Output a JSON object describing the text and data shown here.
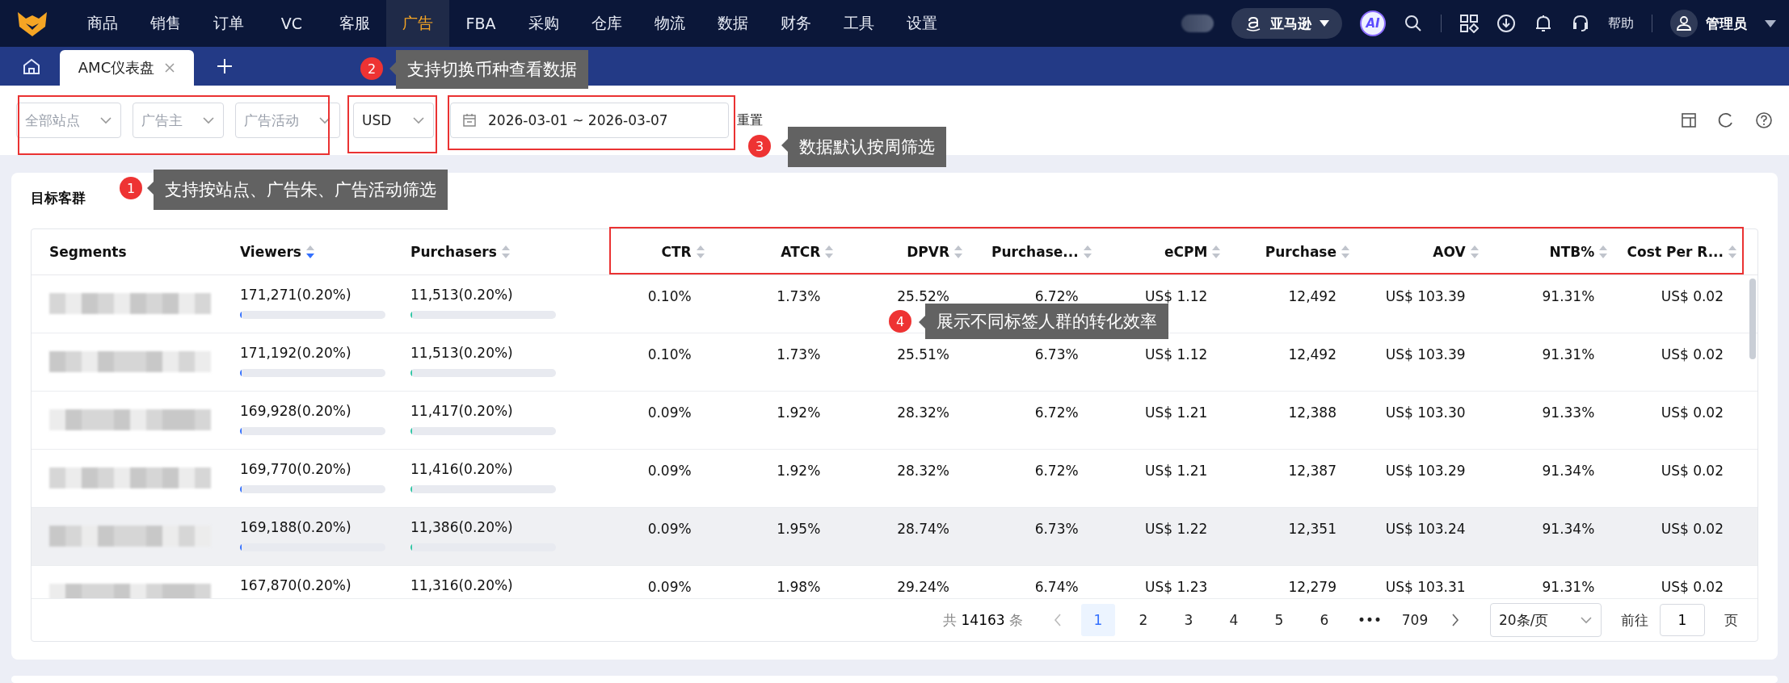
{
  "nav": {
    "items": [
      {
        "label": "商品",
        "selected": false
      },
      {
        "label": "销售",
        "selected": false
      },
      {
        "label": "订单",
        "selected": false
      },
      {
        "label": "VC",
        "selected": false
      },
      {
        "label": "客服",
        "selected": false
      },
      {
        "label": "广告",
        "selected": true
      },
      {
        "label": "FBA",
        "selected": false
      },
      {
        "label": "采购",
        "selected": false
      },
      {
        "label": "仓库",
        "selected": false
      },
      {
        "label": "物流",
        "selected": false
      },
      {
        "label": "数据",
        "selected": false
      },
      {
        "label": "财务",
        "selected": false
      },
      {
        "label": "工具",
        "selected": false
      },
      {
        "label": "设置",
        "selected": false
      }
    ],
    "platform": "亚马逊",
    "ai": "AI",
    "help": "帮助",
    "user": "管理员"
  },
  "tabs": [
    {
      "label": "AMC仪表盘",
      "selected": true
    }
  ],
  "filters": {
    "site": {
      "placeholder": "全部站点"
    },
    "advertiser": {
      "placeholder": "广告主"
    },
    "campaign": {
      "placeholder": "广告活动"
    },
    "currency": {
      "value": "USD"
    },
    "date_range": {
      "value": "2026-03-01 ~ 2026-03-07"
    },
    "reset": "重置"
  },
  "card": {
    "title": "目标客群",
    "table": {
      "columns": [
        {
          "label": "Segments"
        },
        {
          "label": "Viewers",
          "sorted_desc": true
        },
        {
          "label": "Purchasers",
          "sorted_desc": false
        },
        {
          "label": "CTR",
          "sorted_desc": false
        },
        {
          "label": "ATCR",
          "sorted_desc": false
        },
        {
          "label": "DPVR",
          "sorted_desc": false
        },
        {
          "label": "Purchase...",
          "sorted_desc": false
        },
        {
          "label": "eCPM",
          "sorted_desc": false
        },
        {
          "label": "Purchase",
          "sorted_desc": false
        },
        {
          "label": "AOV",
          "sorted_desc": false
        },
        {
          "label": "NTB%",
          "sorted_desc": false
        },
        {
          "label": "Cost Per R...",
          "sorted_desc": false
        }
      ],
      "rows": [
        {
          "highlighted": false,
          "viewers": {
            "text": "171,271(0.20%)",
            "level": 0.01
          },
          "purchasers": {
            "text": "11,513(0.20%)",
            "level": 0.01
          },
          "metrics": [
            "0.10%",
            "1.73%",
            "25.52%",
            "6.72%",
            "US$ 1.12",
            "12,492",
            "US$ 103.39",
            "91.31%",
            "US$ 0.02"
          ]
        },
        {
          "highlighted": false,
          "viewers": {
            "text": "171,192(0.20%)",
            "level": 0.01
          },
          "purchasers": {
            "text": "11,513(0.20%)",
            "level": 0.01
          },
          "metrics": [
            "0.10%",
            "1.73%",
            "25.51%",
            "6.73%",
            "US$ 1.12",
            "12,492",
            "US$ 103.39",
            "91.31%",
            "US$ 0.02"
          ]
        },
        {
          "highlighted": false,
          "viewers": {
            "text": "169,928(0.20%)",
            "level": 0.01
          },
          "purchasers": {
            "text": "11,417(0.20%)",
            "level": 0.01
          },
          "metrics": [
            "0.09%",
            "1.92%",
            "28.32%",
            "6.72%",
            "US$ 1.21",
            "12,388",
            "US$ 103.30",
            "91.33%",
            "US$ 0.02"
          ]
        },
        {
          "highlighted": false,
          "viewers": {
            "text": "169,770(0.20%)",
            "level": 0.01
          },
          "purchasers": {
            "text": "11,416(0.20%)",
            "level": 0.01
          },
          "metrics": [
            "0.09%",
            "1.92%",
            "28.32%",
            "6.72%",
            "US$ 1.21",
            "12,387",
            "US$ 103.29",
            "91.34%",
            "US$ 0.02"
          ]
        },
        {
          "highlighted": true,
          "viewers": {
            "text": "169,188(0.20%)",
            "level": 0.01
          },
          "purchasers": {
            "text": "11,386(0.20%)",
            "level": 0.01
          },
          "metrics": [
            "0.09%",
            "1.95%",
            "28.74%",
            "6.73%",
            "US$ 1.22",
            "12,351",
            "US$ 103.24",
            "91.34%",
            "US$ 0.02"
          ]
        },
        {
          "highlighted": false,
          "viewers": {
            "text": "167,870(0.20%)"
          },
          "purchasers": {
            "text": "11,316(0.20%)"
          },
          "metrics": [
            "0.09%",
            "1.98%",
            "29.24%",
            "6.74%",
            "US$ 1.23",
            "12,279",
            "US$ 103.31",
            "91.31%",
            "US$ 0.02"
          ]
        }
      ]
    },
    "pagination": {
      "total_prefix": "共",
      "total": "14163",
      "total_suffix": "条",
      "pages": [
        {
          "label": "1",
          "selected": true
        },
        {
          "label": "2",
          "selected": false
        },
        {
          "label": "3",
          "selected": false
        },
        {
          "label": "4",
          "selected": false
        },
        {
          "label": "5",
          "selected": false
        },
        {
          "label": "6",
          "selected": false
        },
        {
          "label": "•••",
          "selected": false
        },
        {
          "label": "709",
          "selected": false
        }
      ],
      "page_size": "20条/页",
      "goto_label": "前往",
      "goto_value": "1",
      "goto_suffix": "页"
    }
  },
  "annotations": [
    {
      "number": "1",
      "text": "支持按站点、广告朱、广告活动筛选"
    },
    {
      "number": "2",
      "text": "支持切换币种查看数据"
    },
    {
      "number": "3",
      "text": "数据默认按周筛选"
    },
    {
      "number": "4",
      "text": "展示不同标签人群的转化效率"
    }
  ]
}
